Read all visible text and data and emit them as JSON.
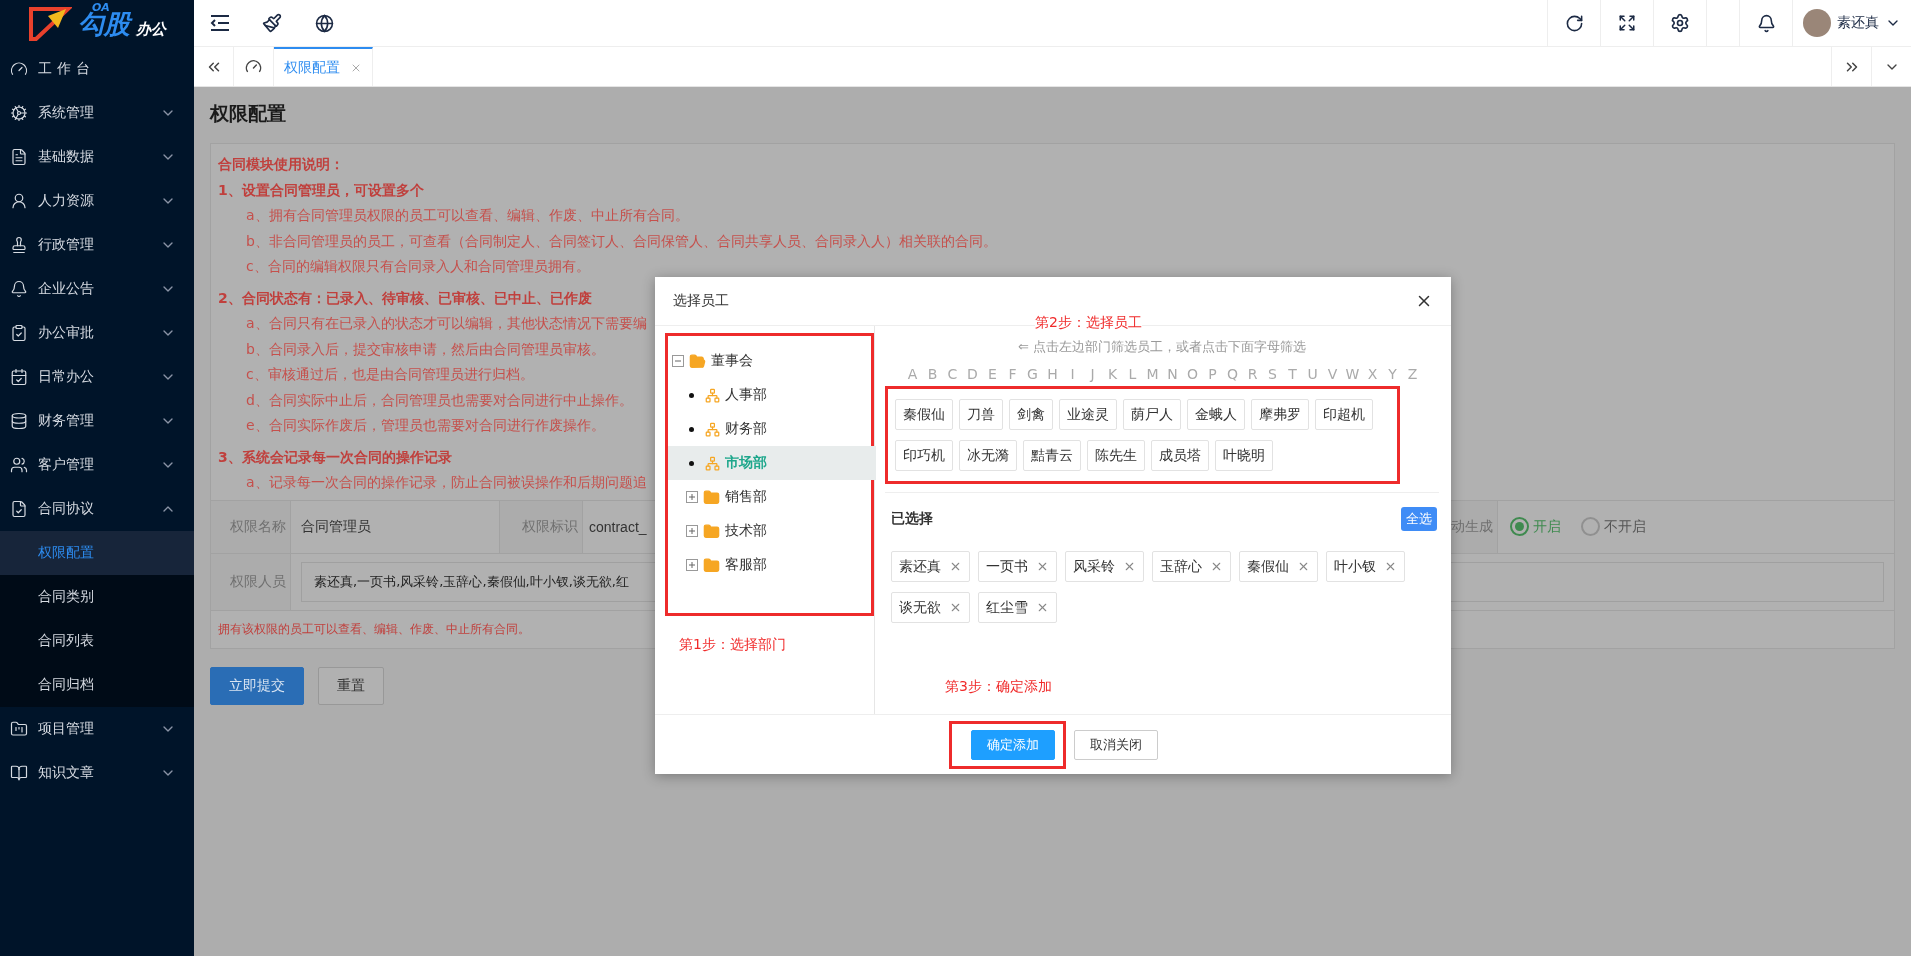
{
  "logo": {
    "superscript": "OA",
    "name": "勾股",
    "suffix": "办公"
  },
  "sidebar": {
    "items": [
      {
        "label": "工作台",
        "kind": "link"
      },
      {
        "label": "系统管理",
        "kind": "group",
        "expanded": false
      },
      {
        "label": "基础数据",
        "kind": "group",
        "expanded": false
      },
      {
        "label": "人力资源",
        "kind": "group",
        "expanded": false
      },
      {
        "label": "行政管理",
        "kind": "group",
        "expanded": false
      },
      {
        "label": "企业公告",
        "kind": "group",
        "expanded": false
      },
      {
        "label": "办公审批",
        "kind": "group",
        "expanded": false
      },
      {
        "label": "日常办公",
        "kind": "group",
        "expanded": false
      },
      {
        "label": "财务管理",
        "kind": "group",
        "expanded": false
      },
      {
        "label": "客户管理",
        "kind": "group",
        "expanded": false
      },
      {
        "label": "合同协议",
        "kind": "group",
        "expanded": true,
        "children": [
          {
            "label": "权限配置",
            "selected": true
          },
          {
            "label": "合同类别",
            "selected": false
          },
          {
            "label": "合同列表",
            "selected": false
          },
          {
            "label": "合同归档",
            "selected": false
          }
        ]
      },
      {
        "label": "项目管理",
        "kind": "group",
        "expanded": false
      },
      {
        "label": "知识文章",
        "kind": "group",
        "expanded": false
      }
    ]
  },
  "topbar": {
    "user": "素还真"
  },
  "tabs": [
    {
      "label": "权限配置",
      "selected": true
    }
  ],
  "page": {
    "title": "权限配置",
    "notes": [
      {
        "kind": "heading",
        "text": "合同模块使用说明："
      },
      {
        "kind": "heading",
        "text": "1、设置合同管理员，可设置多个"
      },
      {
        "kind": "item",
        "text": "a、拥有合同管理员权限的员工可以查看、编辑、作废、中止所有合同。"
      },
      {
        "kind": "item",
        "text": "b、非合同管理员的员工，可查看（合同制定人、合同签订人、合同保管人、合同共享人员、合同录入人）相关联的合同。"
      },
      {
        "kind": "item",
        "text": "c、合同的编辑权限只有合同录入人和合同管理员拥有。"
      },
      {
        "kind": "heading",
        "text": "2、合同状态有：已录入、待审核、已审核、已中止、已作废"
      },
      {
        "kind": "item",
        "text": "a、合同只有在已录入的状态才可以编辑，其他状态情况下需要编"
      },
      {
        "kind": "item",
        "text": "b、合同录入后，提交审核申请，然后由合同管理员审核。"
      },
      {
        "kind": "item",
        "text": "c、审核通过后，也是由合同管理员进行归档。"
      },
      {
        "kind": "item",
        "text": "d、合同实际中止后，合同管理员也需要对合同进行中止操作。"
      },
      {
        "kind": "item",
        "text": "e、合同实际作废后，管理员也需要对合同进行作废操作。"
      },
      {
        "kind": "heading",
        "text": "3、系统会记录每一次合同的操作记录"
      },
      {
        "kind": "item",
        "text": "a、记录每一次合同的操作记录，防止合同被误操作和后期问题追"
      }
    ],
    "form": {
      "name_label": "权限名称",
      "name_value": "合同管理员",
      "code_label": "权限标识",
      "code_value": "contract_",
      "auto_label": "动生成",
      "auto_options": [
        {
          "label": "开启",
          "selected": true
        },
        {
          "label": "不开启",
          "selected": false
        }
      ],
      "members_label": "权限人员",
      "members_value": "素还真,一页书,风采铃,玉辞心,秦假仙,叶小钗,谈无欲,红"
    },
    "hint": "拥有该权限的员工可以查看、编辑、作废、中止所有合同。",
    "buttons": [
      {
        "label": "立即提交",
        "kind": "primary"
      },
      {
        "label": "重置",
        "kind": "default"
      }
    ]
  },
  "dialog": {
    "title": "选择员工",
    "tree": {
      "label": "董事会",
      "expanded": true,
      "children": [
        {
          "label": "人事部",
          "kind": "leaf",
          "selected": false
        },
        {
          "label": "财务部",
          "kind": "leaf",
          "selected": false
        },
        {
          "label": "市场部",
          "kind": "leaf",
          "selected": true
        },
        {
          "label": "销售部",
          "kind": "folder",
          "selected": false
        },
        {
          "label": "技术部",
          "kind": "folder",
          "selected": false
        },
        {
          "label": "客服部",
          "kind": "folder",
          "selected": false
        }
      ]
    },
    "step1": "第1步：选择部门",
    "step2": "第2步：选择员工",
    "step3": "第3步：确定添加",
    "filter_hint": "⇐ 点击左边部门筛选员工，或者点击下面字母筛选",
    "letters": [
      "A",
      "B",
      "C",
      "D",
      "E",
      "F",
      "G",
      "H",
      "I",
      "J",
      "K",
      "L",
      "M",
      "N",
      "O",
      "P",
      "Q",
      "R",
      "S",
      "T",
      "U",
      "V",
      "W",
      "X",
      "Y",
      "Z"
    ],
    "employees": [
      "秦假仙",
      "刀兽",
      "剑禽",
      "业途灵",
      "荫尸人",
      "金蛾人",
      "摩弗罗",
      "印超机",
      "印巧机",
      "冰无漪",
      "黠青云",
      "陈先生",
      "成员塔",
      "叶晓明"
    ],
    "selected_title": "已选择",
    "select_all": "全选",
    "selected": [
      "素还真",
      "一页书",
      "风采铃",
      "玉辞心",
      "秦假仙",
      "叶小钗",
      "谈无欲",
      "红尘雪"
    ],
    "buttons": [
      {
        "label": "确定添加",
        "kind": "primary"
      },
      {
        "label": "取消关闭",
        "kind": "default"
      }
    ]
  }
}
